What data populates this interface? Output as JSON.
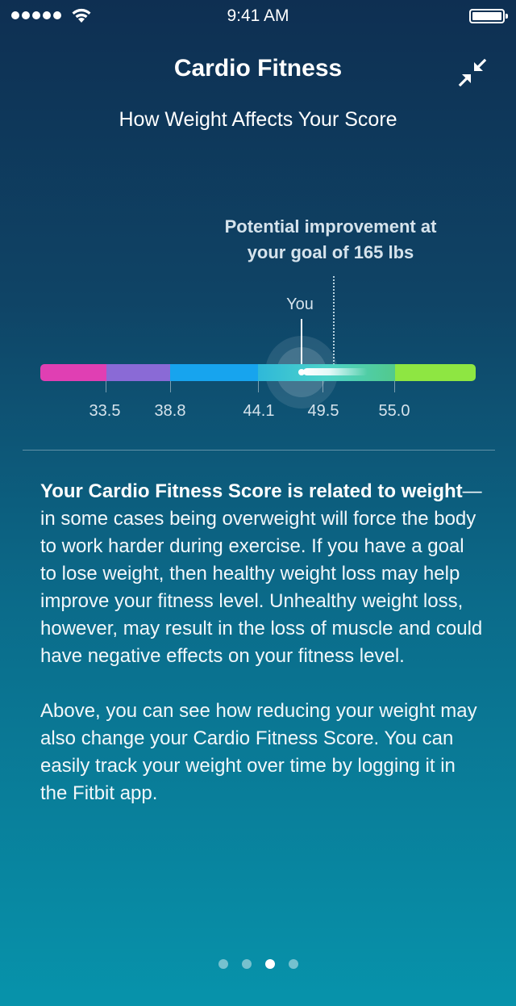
{
  "status_bar": {
    "time": "9:41 AM"
  },
  "header": {
    "title": "Cardio Fitness",
    "subtitle": "How Weight Affects Your Score",
    "collapse_icon": "collapse-arrows-icon"
  },
  "chart": {
    "potential_label_line1": "Potential improvement at",
    "potential_label_line2": "your goal of 165 lbs",
    "you_label": "You",
    "tick_labels": [
      "33.5",
      "38.8",
      "44.1",
      "49.5",
      "55.0"
    ],
    "segment_colors": [
      "#e03fb3",
      "#8a6ad6",
      "#17a4ee",
      "#4cd3c9",
      "#8ee642"
    ]
  },
  "content": {
    "para1_bold": "Your Cardio Fitness Score is related to weight",
    "para1_rest": "—in some cases being overweight will force the body to work harder during exercise. If you have a goal to lose weight, then healthy weight loss may help improve your fitness level. Unhealthy weight loss, however, may result in the loss of muscle and could have negative effects on your fitness level.",
    "para2": "Above, you can see how reducing your weight may also change your Cardio Fitness Score. You can easily track your weight over time by logging it in the Fitbit app."
  },
  "pagination": {
    "total": 4,
    "active_index": 2
  }
}
